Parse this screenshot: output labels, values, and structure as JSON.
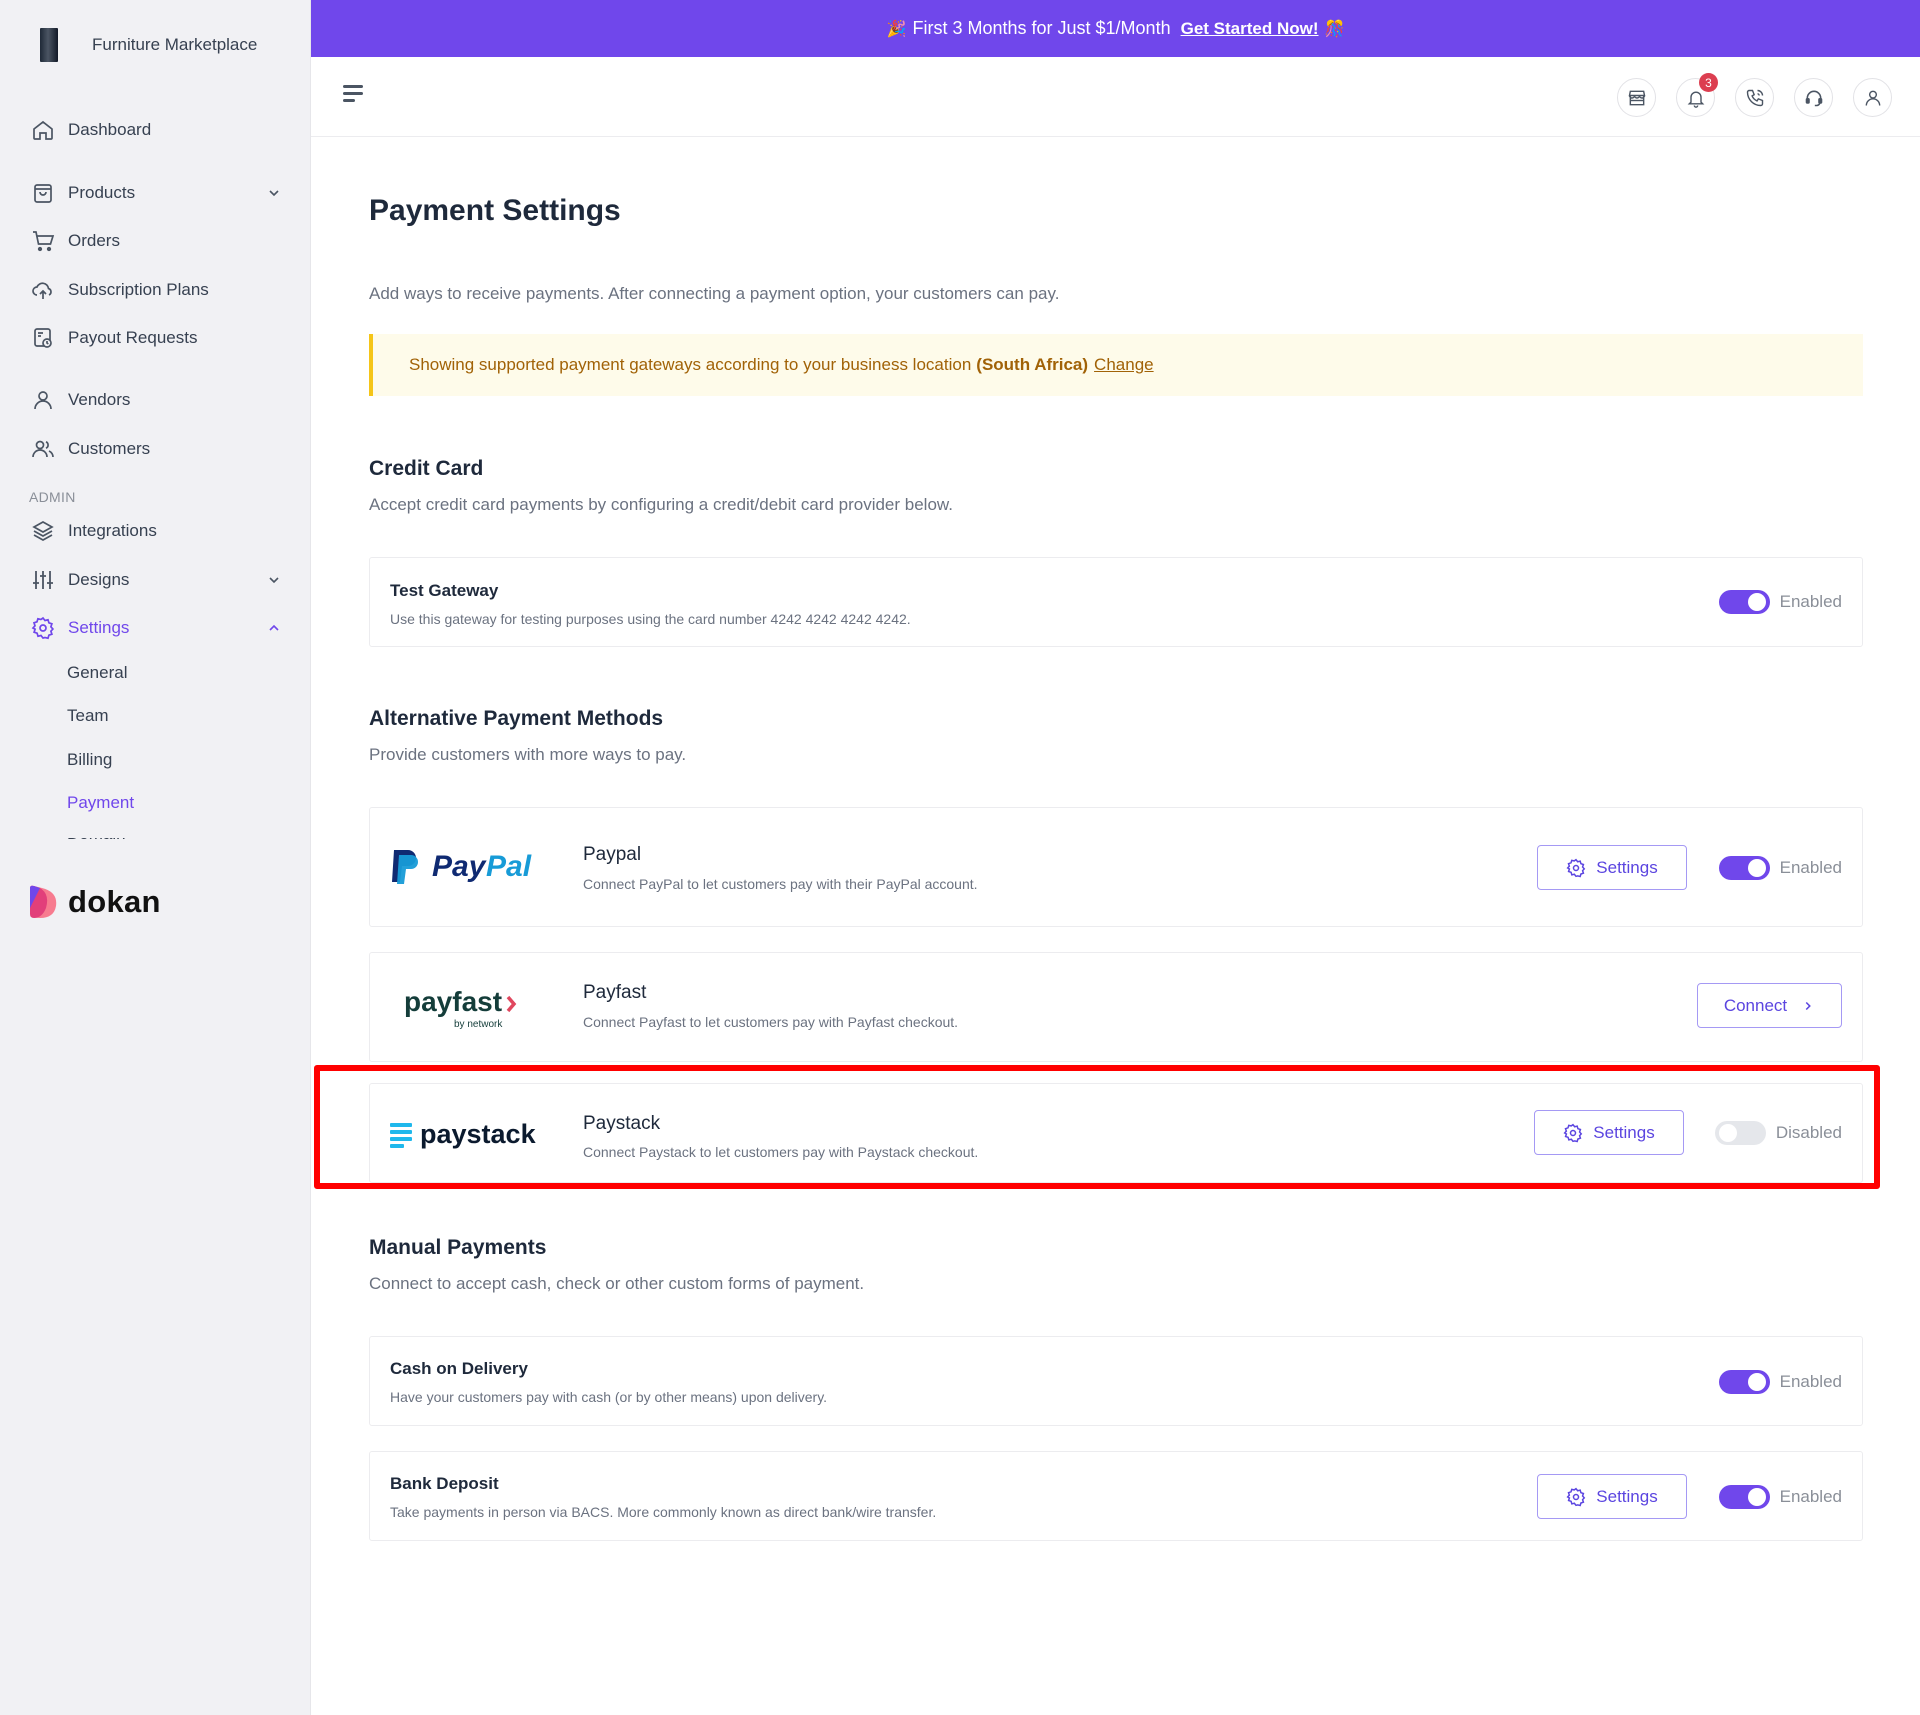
{
  "sidebar": {
    "brand_name": "Furniture Marketplace",
    "items": [
      {
        "label": "Dashboard",
        "icon": "home-icon"
      },
      {
        "label": "Products",
        "icon": "bag-icon",
        "expandable": true
      },
      {
        "label": "Orders",
        "icon": "cart-icon"
      },
      {
        "label": "Subscription Plans",
        "icon": "cloud-upload-icon"
      },
      {
        "label": "Payout Requests",
        "icon": "payout-icon"
      },
      {
        "label": "Vendors",
        "icon": "user-icon"
      },
      {
        "label": "Customers",
        "icon": "users-icon"
      }
    ],
    "admin_label": "ADMIN",
    "admin_items": [
      {
        "label": "Integrations",
        "icon": "layers-icon"
      },
      {
        "label": "Designs",
        "icon": "sliders-icon",
        "expandable": true
      },
      {
        "label": "Settings",
        "icon": "gear-icon",
        "expanded": true,
        "active": true
      }
    ],
    "settings_sub": [
      {
        "label": "General"
      },
      {
        "label": "Team"
      },
      {
        "label": "Billing"
      },
      {
        "label": "Payment",
        "active": true
      },
      {
        "label": "Domain"
      }
    ],
    "footer_logo": "dokan"
  },
  "banner": {
    "text": "First 3 Months for Just $1/Month",
    "link": "Get Started Now!",
    "emoji_left": "🎉",
    "emoji_right": "🎊"
  },
  "topbar": {
    "notification_count": "3",
    "icons": [
      "store-icon",
      "bell-icon",
      "phone-icon",
      "headset-icon",
      "user-icon"
    ]
  },
  "page": {
    "title": "Payment Settings",
    "description": "Add ways to receive payments. After connecting a payment option, your customers can pay.",
    "notice": {
      "text": "Showing supported payment gateways according to your business location",
      "location": "(South Africa)",
      "link": "Change"
    }
  },
  "credit_card": {
    "title": "Credit Card",
    "description": "Accept credit card payments by configuring a credit/debit card provider below.",
    "gateways": [
      {
        "name": "Test Gateway",
        "description": "Use this gateway for testing purposes using the card number 4242 4242 4242 4242.",
        "status": "Enabled"
      }
    ]
  },
  "alternative": {
    "title": "Alternative Payment Methods",
    "description": "Provide customers with more ways to pay.",
    "gateways": [
      {
        "name": "Paypal",
        "logo": "PayPal",
        "description": "Connect PayPal to let customers pay with their PayPal account.",
        "button": "Settings",
        "status": "Enabled"
      },
      {
        "name": "Payfast",
        "logo": "payfast",
        "logo_sub": "by network",
        "description": "Connect Payfast to let customers pay with Payfast checkout.",
        "button": "Connect"
      },
      {
        "name": "Paystack",
        "logo": "paystack",
        "description": "Connect Paystack to let customers pay with Paystack checkout.",
        "button": "Settings",
        "status": "Disabled"
      }
    ]
  },
  "manual": {
    "title": "Manual Payments",
    "description": "Connect to accept cash, check or other custom forms of payment.",
    "gateways": [
      {
        "name": "Cash on Delivery",
        "description": "Have your customers pay with cash (or by other means) upon delivery.",
        "status": "Enabled"
      },
      {
        "name": "Bank Deposit",
        "description": "Take payments in person via BACS. More commonly known as direct bank/wire transfer.",
        "button": "Settings",
        "status": "Enabled"
      }
    ]
  },
  "colors": {
    "accent": "#7047eb",
    "highlight": "#ff0000",
    "notice_bg": "#fefbea",
    "notice_border": "#f5c518",
    "badge": "#dc3e50"
  }
}
